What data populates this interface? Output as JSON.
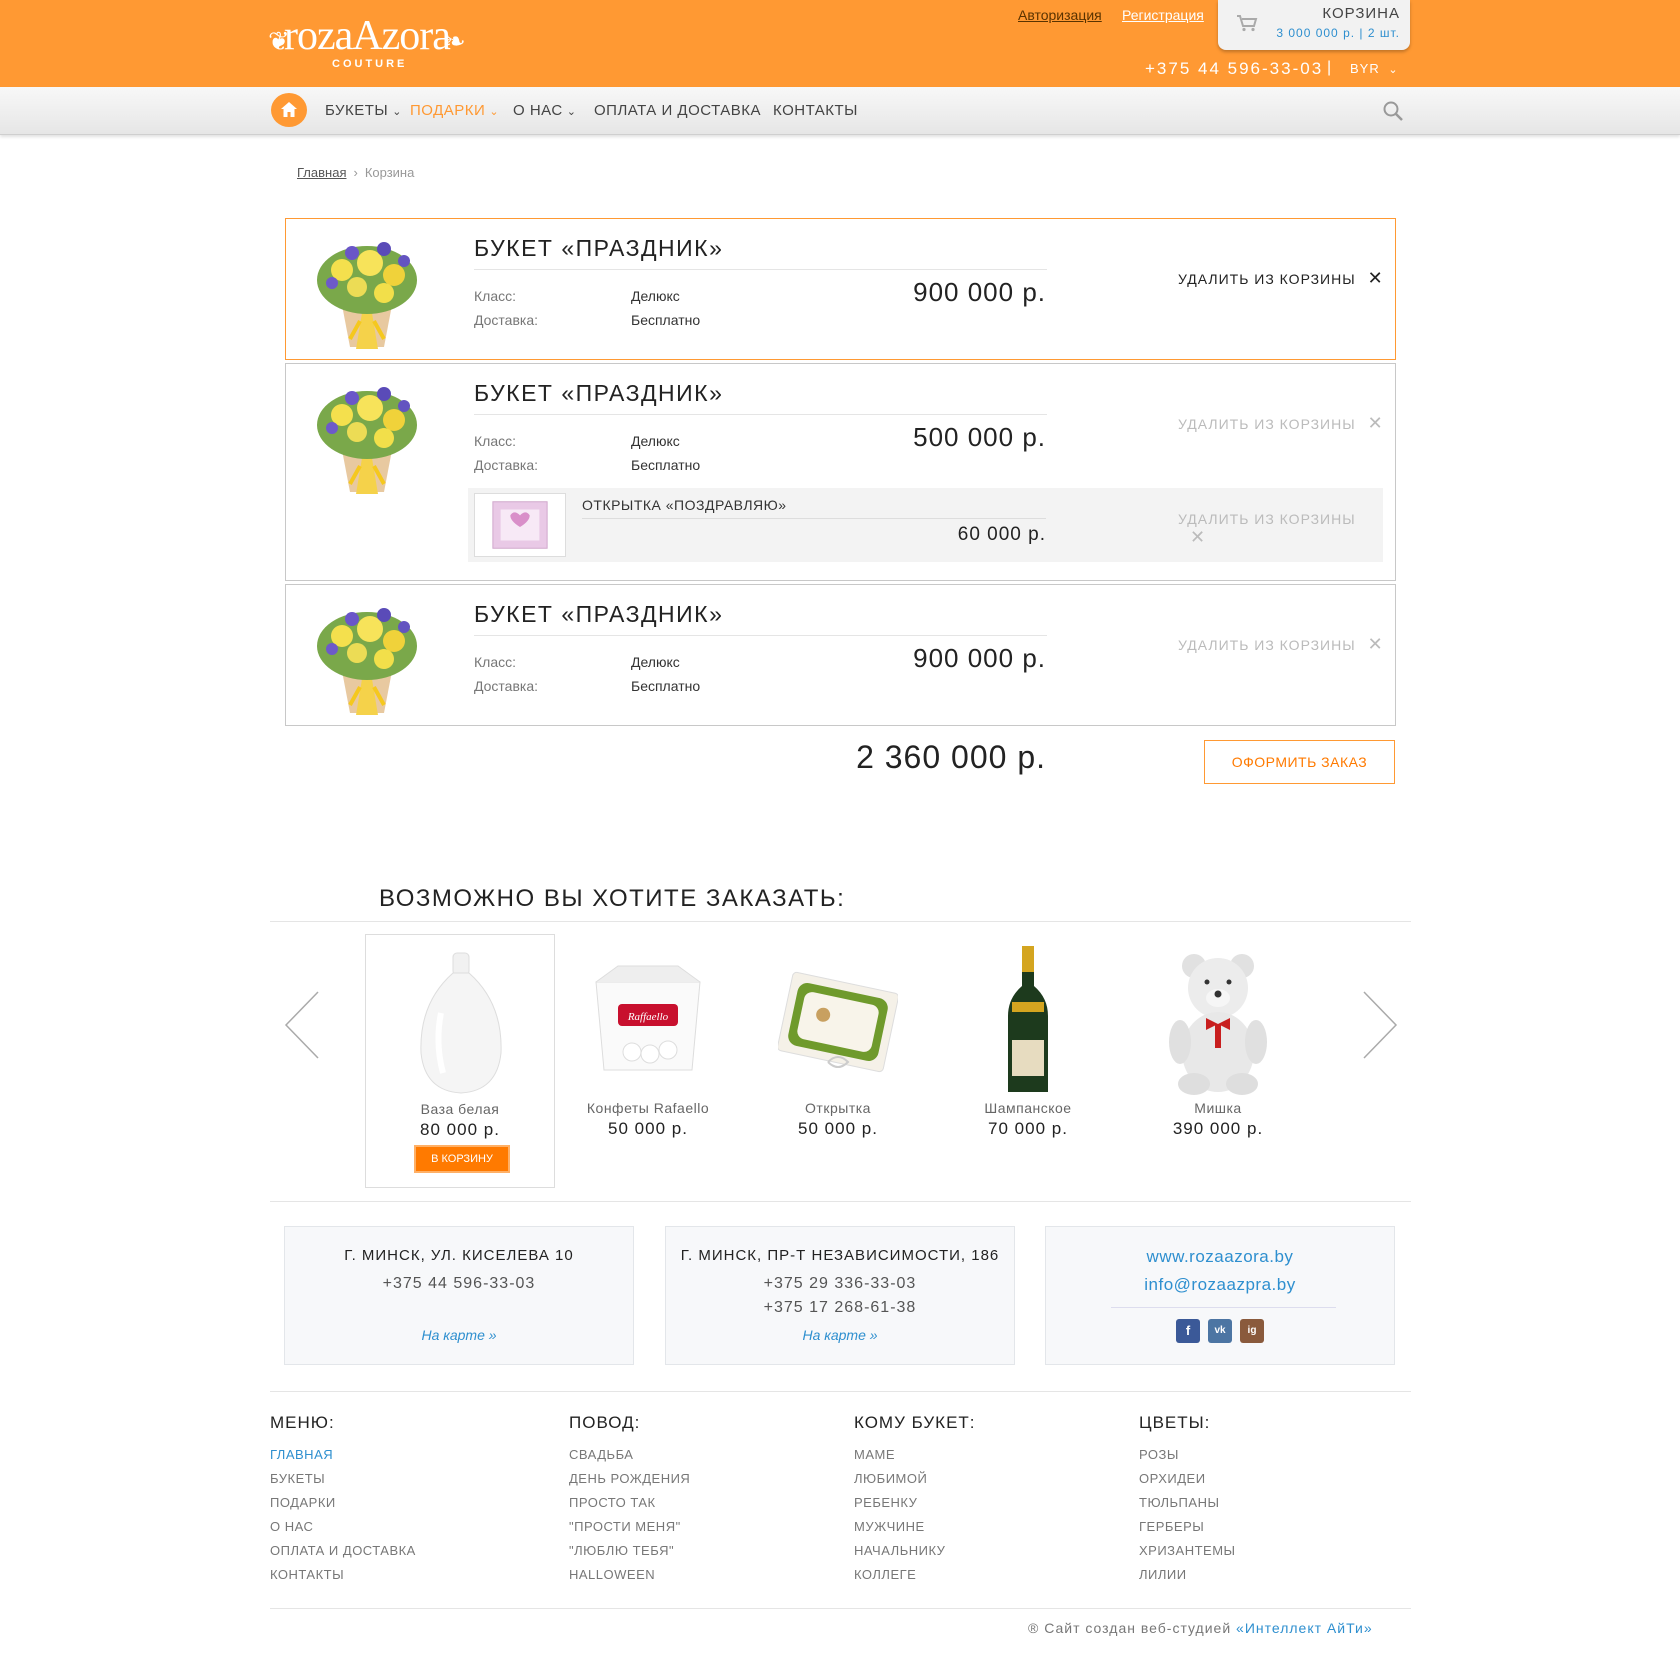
{
  "header": {
    "logo_text": "rozaAzora",
    "logo_sub": "COUTURE",
    "login": "Авторизация",
    "register": "Регистрация",
    "cart_title": "КОРЗИНА",
    "cart_summary": "3 000 000 р.  |  2 шт.",
    "phone": "+375 44 596-33-03",
    "separator": "|",
    "currency": "BYR"
  },
  "nav": {
    "items": [
      {
        "label": "БУКЕТЫ",
        "dropdown": true
      },
      {
        "label": "ПОДАРКИ",
        "dropdown": true
      },
      {
        "label": "О НАС",
        "dropdown": true
      },
      {
        "label": "ОПЛАТА И ДОСТАВКА",
        "dropdown": false
      },
      {
        "label": "КОНТАКТЫ",
        "dropdown": false
      }
    ],
    "chevron": "⌄"
  },
  "breadcrumb": {
    "home": "Главная",
    "sep": "›",
    "current": "Корзина"
  },
  "cart": {
    "items": [
      {
        "title": "БУКЕТ «ПРАЗДНИК»",
        "class_label": "Класс:",
        "class_value": "Делюкс",
        "delivery_label": "Доставка:",
        "delivery_value": "Бесплатно",
        "price": "900 000 р.",
        "remove": "УДАЛИТЬ ИЗ КОРЗИНЫ"
      },
      {
        "title": "БУКЕТ «ПРАЗДНИК»",
        "class_label": "Класс:",
        "class_value": "Делюкс",
        "delivery_label": "Доставка:",
        "delivery_value": "Бесплатно",
        "price": "500 000 р.",
        "remove": "УДАЛИТЬ ИЗ КОРЗИНЫ",
        "addon": {
          "title": "ОТКРЫТКА «ПОЗДРАВЛЯЮ»",
          "price": "60 000 р.",
          "remove": "УДАЛИТЬ ИЗ КОРЗИНЫ"
        }
      },
      {
        "title": "БУКЕТ «ПРАЗДНИК»",
        "class_label": "Класс:",
        "class_value": "Делюкс",
        "delivery_label": "Доставка:",
        "delivery_value": "Бесплатно",
        "price": "900 000 р.",
        "remove": "УДАЛИТЬ ИЗ КОРЗИНЫ"
      }
    ],
    "remove_icon": "✕",
    "total": "2 360 000 р.",
    "order_button": "ОФОРМИТЬ ЗАКАЗ"
  },
  "suggestions": {
    "title": "ВОЗМОЖНО ВЫ ХОТИТЕ ЗАКАЗАТЬ:",
    "items": [
      {
        "name": "Ваза белая",
        "price": "80 000 р.",
        "button": "В КОРЗИНУ"
      },
      {
        "name": "Конфеты Rafaello",
        "price": "50 000 р."
      },
      {
        "name": "Открытка",
        "price": "50 000 р."
      },
      {
        "name": "Шампанское",
        "price": "70 000 р."
      },
      {
        "name": "Мишка",
        "price": "390 000 р."
      }
    ]
  },
  "contacts": [
    {
      "title": "Г. МИНСК, УЛ. КИСЕЛЕВА 10",
      "phones": [
        "+375 44 596-33-03"
      ],
      "map": "На карте  »"
    },
    {
      "title": "Г. МИНСК, ПР-Т НЕЗАВИСИМОСТИ, 186",
      "phones": [
        "+375 29 336-33-03",
        "+375 17 268-61-38"
      ],
      "map": "На карте  »"
    },
    {
      "site": "www.rozaazora.by",
      "email": "info@rozaazpra.by",
      "social": [
        "f",
        "vk",
        "ig"
      ]
    }
  ],
  "footer": {
    "columns": [
      {
        "title": "МЕНЮ:",
        "items": [
          "ГЛАВНАЯ",
          "БУКЕТЫ",
          "ПОДАРКИ",
          "О НАС",
          "ОПЛАТА И ДОСТАВКА",
          "КОНТАКТЫ"
        ]
      },
      {
        "title": "ПОВОД:",
        "items": [
          "СВАДЬБА",
          "ДЕНЬ РОЖДЕНИЯ",
          "ПРОСТО ТАК",
          "\"ПРОСТИ МЕНЯ\"",
          "\"ЛЮБЛЮ ТЕБЯ\"",
          "HALLOWEEN"
        ]
      },
      {
        "title": "КОМУ БУКЕТ:",
        "items": [
          "МАМЕ",
          "ЛЮБИМОЙ",
          "РЕБЕНКУ",
          "МУЖЧИНЕ",
          "НАЧАЛЬНИКУ",
          "КОЛЛЕГЕ"
        ]
      },
      {
        "title": "ЦВЕТЫ:",
        "items": [
          "РОЗЫ",
          "ОРХИДЕИ",
          "ТЮЛЬПАНЫ",
          "ГЕРБЕРЫ",
          "ХРИЗАНТЕМЫ",
          "ЛИЛИИ"
        ]
      }
    ],
    "credit_prefix": "® Сайт создан веб-студией ",
    "credit_link": "«Интеллект АйТи»"
  },
  "colors": {
    "accent": "#ff9933",
    "link": "#2e8fcf",
    "button": "#ff7a00"
  }
}
